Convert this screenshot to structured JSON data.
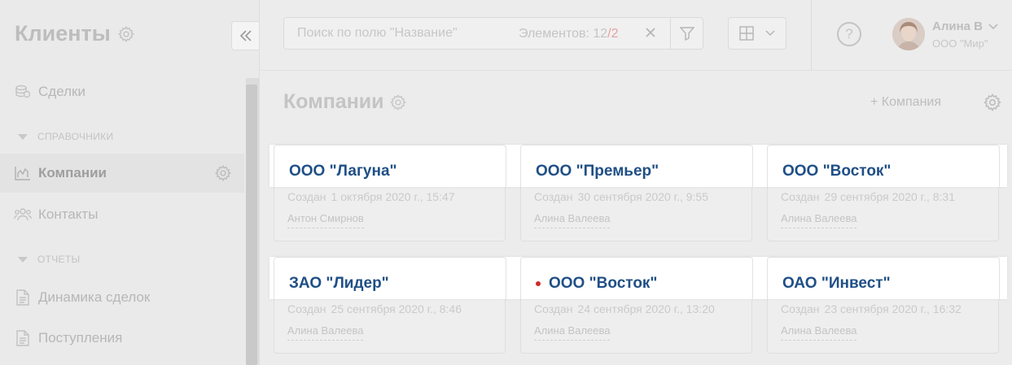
{
  "app": {
    "title": "Клиенты"
  },
  "sidebar": {
    "items": [
      {
        "label": "Сделки",
        "icon": "coins-icon"
      },
      {
        "label": "Компании",
        "icon": "bar-chart-icon",
        "active": true
      },
      {
        "label": "Контакты",
        "icon": "users-icon"
      },
      {
        "label": "Динамика сделок",
        "icon": "document-icon"
      },
      {
        "label": "Поступления",
        "icon": "document-icon"
      }
    ],
    "sections": [
      "СПРАВОЧНИКИ",
      "ОТЧЕТЫ"
    ]
  },
  "search": {
    "placeholder": "Поиск по полю \"Название\"",
    "count_label": "Элементов: 12",
    "count_sep": "/",
    "selected": "2"
  },
  "user": {
    "name": "Алина В",
    "org": "ООО \"Мир\""
  },
  "page": {
    "title": "Компании",
    "add_button": "+ Компания"
  },
  "cards": [
    {
      "name": "ООО \"Лагуна\"",
      "created_label": "Создан",
      "created": "1 октября 2020 г., 15:47",
      "author": "Антон Смирнов"
    },
    {
      "name": "ООО \"Премьер\"",
      "created_label": "Создан",
      "created": "30 сентября 2020 г., 9:55",
      "author": "Алина Валеева"
    },
    {
      "name": "ООО \"Восток\"",
      "created_label": "Создан",
      "created": "29 сентября 2020 г., 8:31",
      "author": "Алина Валеева"
    },
    {
      "name": "ЗАО \"Лидер\"",
      "created_label": "Создан",
      "created": "25 сентября 2020 г., 8:46",
      "author": "Алина Валеева"
    },
    {
      "name": "ООО \"Восток\"",
      "created_label": "Создан",
      "created": "24 сентября 2020 г., 13:20",
      "author": "Алина Валеева",
      "unread": true
    },
    {
      "name": "ОАО \"Инвест\"",
      "created_label": "Создан",
      "created": "23 сентября 2020 г., 16:32",
      "author": "Алина Валеева"
    }
  ],
  "colors": {
    "link": "#1f4f86",
    "unread_dot": "#d02a2a"
  }
}
